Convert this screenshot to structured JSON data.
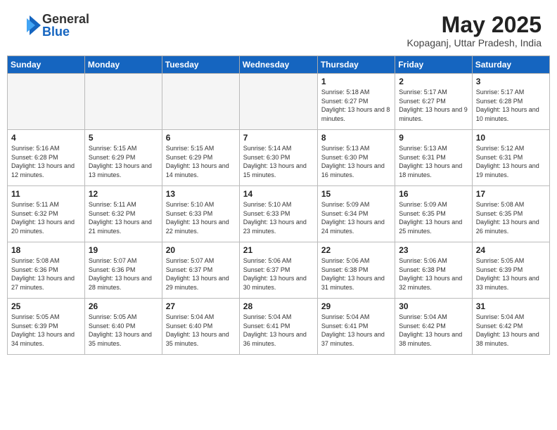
{
  "header": {
    "logo_general": "General",
    "logo_blue": "Blue",
    "month_year": "May 2025",
    "location": "Kopaganj, Uttar Pradesh, India"
  },
  "weekdays": [
    "Sunday",
    "Monday",
    "Tuesday",
    "Wednesday",
    "Thursday",
    "Friday",
    "Saturday"
  ],
  "weeks": [
    [
      {
        "day": "",
        "empty": true
      },
      {
        "day": "",
        "empty": true
      },
      {
        "day": "",
        "empty": true
      },
      {
        "day": "",
        "empty": true
      },
      {
        "day": "1",
        "sunrise": "5:18 AM",
        "sunset": "6:27 PM",
        "daylight": "13 hours and 8 minutes."
      },
      {
        "day": "2",
        "sunrise": "5:17 AM",
        "sunset": "6:27 PM",
        "daylight": "13 hours and 9 minutes."
      },
      {
        "day": "3",
        "sunrise": "5:17 AM",
        "sunset": "6:28 PM",
        "daylight": "13 hours and 10 minutes."
      }
    ],
    [
      {
        "day": "4",
        "sunrise": "5:16 AM",
        "sunset": "6:28 PM",
        "daylight": "13 hours and 12 minutes."
      },
      {
        "day": "5",
        "sunrise": "5:15 AM",
        "sunset": "6:29 PM",
        "daylight": "13 hours and 13 minutes."
      },
      {
        "day": "6",
        "sunrise": "5:15 AM",
        "sunset": "6:29 PM",
        "daylight": "13 hours and 14 minutes."
      },
      {
        "day": "7",
        "sunrise": "5:14 AM",
        "sunset": "6:30 PM",
        "daylight": "13 hours and 15 minutes."
      },
      {
        "day": "8",
        "sunrise": "5:13 AM",
        "sunset": "6:30 PM",
        "daylight": "13 hours and 16 minutes."
      },
      {
        "day": "9",
        "sunrise": "5:13 AM",
        "sunset": "6:31 PM",
        "daylight": "13 hours and 18 minutes."
      },
      {
        "day": "10",
        "sunrise": "5:12 AM",
        "sunset": "6:31 PM",
        "daylight": "13 hours and 19 minutes."
      }
    ],
    [
      {
        "day": "11",
        "sunrise": "5:11 AM",
        "sunset": "6:32 PM",
        "daylight": "13 hours and 20 minutes."
      },
      {
        "day": "12",
        "sunrise": "5:11 AM",
        "sunset": "6:32 PM",
        "daylight": "13 hours and 21 minutes."
      },
      {
        "day": "13",
        "sunrise": "5:10 AM",
        "sunset": "6:33 PM",
        "daylight": "13 hours and 22 minutes."
      },
      {
        "day": "14",
        "sunrise": "5:10 AM",
        "sunset": "6:33 PM",
        "daylight": "13 hours and 23 minutes."
      },
      {
        "day": "15",
        "sunrise": "5:09 AM",
        "sunset": "6:34 PM",
        "daylight": "13 hours and 24 minutes."
      },
      {
        "day": "16",
        "sunrise": "5:09 AM",
        "sunset": "6:35 PM",
        "daylight": "13 hours and 25 minutes."
      },
      {
        "day": "17",
        "sunrise": "5:08 AM",
        "sunset": "6:35 PM",
        "daylight": "13 hours and 26 minutes."
      }
    ],
    [
      {
        "day": "18",
        "sunrise": "5:08 AM",
        "sunset": "6:36 PM",
        "daylight": "13 hours and 27 minutes."
      },
      {
        "day": "19",
        "sunrise": "5:07 AM",
        "sunset": "6:36 PM",
        "daylight": "13 hours and 28 minutes."
      },
      {
        "day": "20",
        "sunrise": "5:07 AM",
        "sunset": "6:37 PM",
        "daylight": "13 hours and 29 minutes."
      },
      {
        "day": "21",
        "sunrise": "5:06 AM",
        "sunset": "6:37 PM",
        "daylight": "13 hours and 30 minutes."
      },
      {
        "day": "22",
        "sunrise": "5:06 AM",
        "sunset": "6:38 PM",
        "daylight": "13 hours and 31 minutes."
      },
      {
        "day": "23",
        "sunrise": "5:06 AM",
        "sunset": "6:38 PM",
        "daylight": "13 hours and 32 minutes."
      },
      {
        "day": "24",
        "sunrise": "5:05 AM",
        "sunset": "6:39 PM",
        "daylight": "13 hours and 33 minutes."
      }
    ],
    [
      {
        "day": "25",
        "sunrise": "5:05 AM",
        "sunset": "6:39 PM",
        "daylight": "13 hours and 34 minutes."
      },
      {
        "day": "26",
        "sunrise": "5:05 AM",
        "sunset": "6:40 PM",
        "daylight": "13 hours and 35 minutes."
      },
      {
        "day": "27",
        "sunrise": "5:04 AM",
        "sunset": "6:40 PM",
        "daylight": "13 hours and 35 minutes."
      },
      {
        "day": "28",
        "sunrise": "5:04 AM",
        "sunset": "6:41 PM",
        "daylight": "13 hours and 36 minutes."
      },
      {
        "day": "29",
        "sunrise": "5:04 AM",
        "sunset": "6:41 PM",
        "daylight": "13 hours and 37 minutes."
      },
      {
        "day": "30",
        "sunrise": "5:04 AM",
        "sunset": "6:42 PM",
        "daylight": "13 hours and 38 minutes."
      },
      {
        "day": "31",
        "sunrise": "5:04 AM",
        "sunset": "6:42 PM",
        "daylight": "13 hours and 38 minutes."
      }
    ]
  ]
}
